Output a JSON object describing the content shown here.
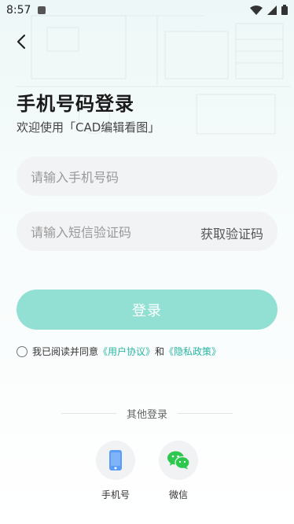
{
  "status_bar": {
    "time": "8:57"
  },
  "header": {
    "back_icon": "chevron-left-icon",
    "title": "手机号码登录",
    "subtitle": "欢迎使用「CAD编辑看图」"
  },
  "form": {
    "phone_placeholder": "请输入手机号码",
    "code_placeholder": "请输入短信验证码",
    "get_code_label": "获取验证码",
    "login_label": "登录"
  },
  "agreement": {
    "prefix": "我已阅读并同意",
    "user_agreement": "《用户协议》",
    "and": "和",
    "privacy_policy": "《隐私政策》"
  },
  "other_login": {
    "label": "其他登录",
    "options": [
      {
        "label": "手机号",
        "icon": "phone-icon"
      },
      {
        "label": "微信",
        "icon": "wechat-icon"
      }
    ]
  },
  "colors": {
    "accent": "#92e0d4",
    "link": "#2bb5a2",
    "phone_icon": "#5b9cf6",
    "wechat_icon": "#2dc84d"
  }
}
